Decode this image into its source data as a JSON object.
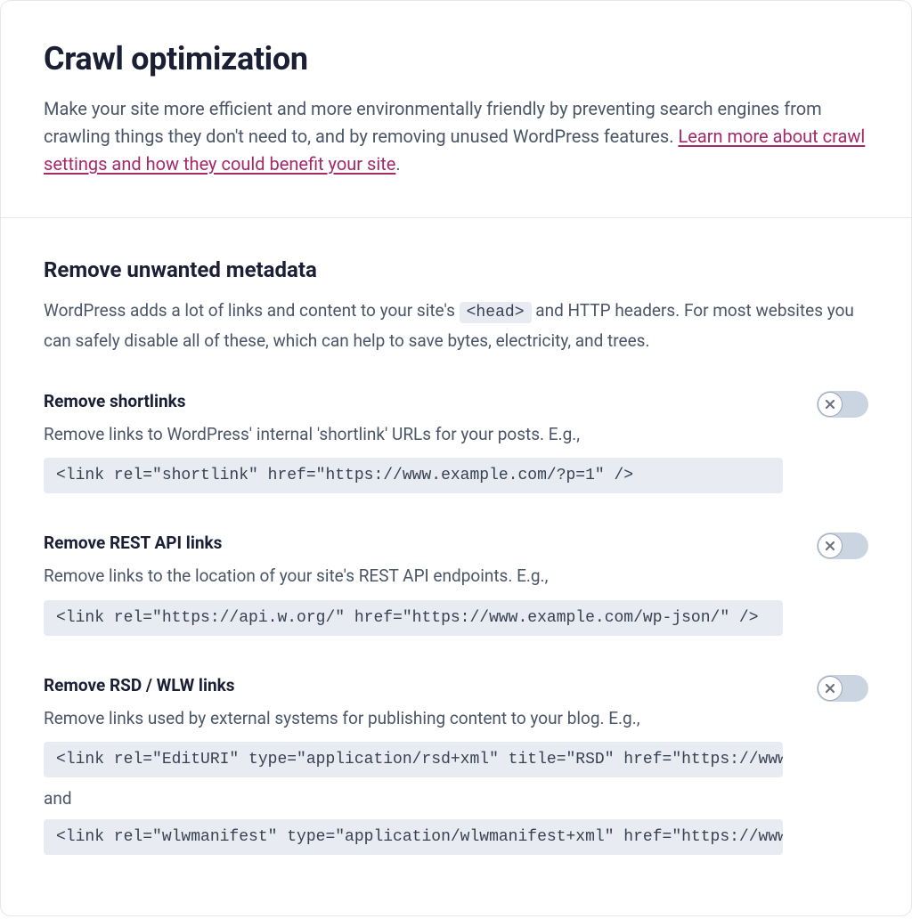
{
  "header": {
    "title": "Crawl optimization",
    "lead_text": "Make your site more efficient and more environmentally friendly by preventing search engines from crawling things they don't need to, and by removing unused WordPress features. ",
    "learn_more_link": "Learn more about crawl settings and how they could benefit your site",
    "lead_suffix": "."
  },
  "section": {
    "title": "Remove unwanted metadata",
    "desc_before": "WordPress adds a lot of links and content to your site's ",
    "desc_code": "<head>",
    "desc_after": " and HTTP headers. For most websites you can safely disable all of these, which can help to save bytes, electricity, and trees."
  },
  "settings": [
    {
      "title": "Remove shortlinks",
      "desc": "Remove links to WordPress' internal 'shortlink' URLs for your posts. E.g.,",
      "code1": "<link rel=\"shortlink\" href=\"https://www.example.com/?p=1\" />",
      "enabled": false
    },
    {
      "title": "Remove REST API links",
      "desc": "Remove links to the location of your site's REST API endpoints. E.g.,",
      "code1": "<link rel=\"https://api.w.org/\" href=\"https://www.example.com/wp-json/\" />",
      "enabled": false
    },
    {
      "title": "Remove RSD / WLW links",
      "desc": "Remove links used by external systems for publishing content to your blog. E.g.,",
      "code1": "<link rel=\"EditURI\" type=\"application/rsd+xml\" title=\"RSD\" href=\"https://www.",
      "between": "and",
      "code2": "<link rel=\"wlwmanifest\" type=\"application/wlwmanifest+xml\" href=\"https://www.",
      "enabled": false
    }
  ]
}
